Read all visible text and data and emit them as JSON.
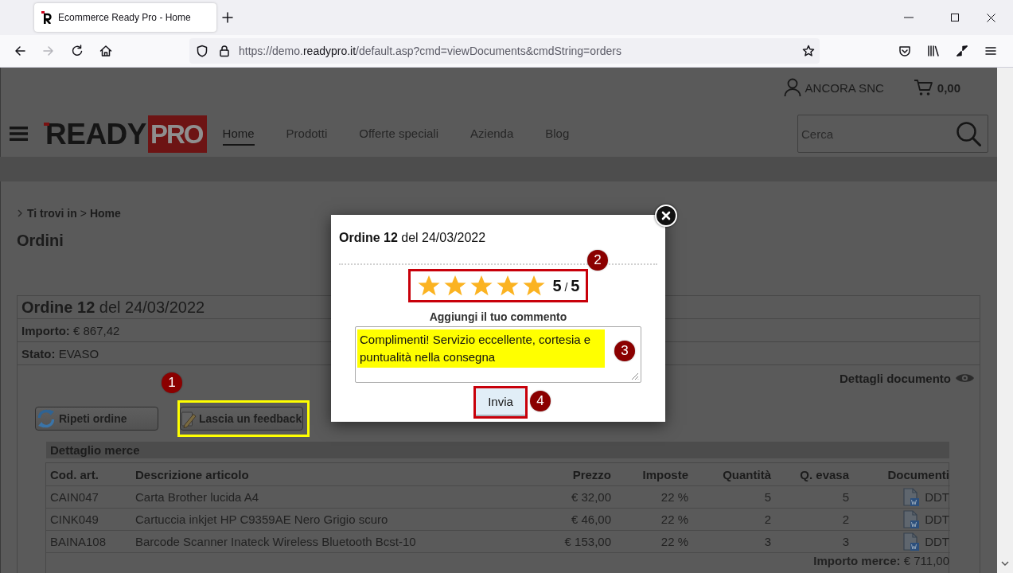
{
  "browser": {
    "tab_title": "Ecommerce Ready Pro - Home",
    "url": {
      "before_host": "https://demo.",
      "host": "readypro.it",
      "after_host": "/default.asp?cmd=viewDocuments&cmdString=orders"
    },
    "forward_disabled": true
  },
  "header": {
    "account": "ANCORA SNC",
    "cart_total": "0,00",
    "logo": {
      "word": "READY",
      "boxed_word": "PRO"
    },
    "nav": [
      {
        "label": "Home",
        "selected": true
      },
      {
        "label": "Prodotti",
        "selected": false
      },
      {
        "label": "Offerte speciali",
        "selected": false
      },
      {
        "label": "Azienda",
        "selected": false
      },
      {
        "label": "Blog",
        "selected": false
      }
    ],
    "search": {
      "placeholder": "Cerca"
    }
  },
  "breadcrumb": {
    "label": "Ti trovi in",
    "separator": ">",
    "current": "Home"
  },
  "page_title": "Ordini",
  "order": {
    "title": "**Ordine 12** del 24/03/2022",
    "amount": "**Importo:** € 867,42",
    "status": "**Stato:** EVASO",
    "details_link": "Dettagli documento",
    "actions": [
      {
        "kind": "repeat",
        "label": "Ripeti ordine",
        "highlighted": false
      },
      {
        "kind": "feedback",
        "label": "Lascia un feedback",
        "highlighted": true,
        "callout": "1"
      }
    ]
  },
  "goods": {
    "title": "Dettaglio merce",
    "columns": [
      "Cod. art.",
      "Descrizione articolo",
      "Prezzo",
      "Imposte",
      "Quantità",
      "Q. evasa",
      "Documenti"
    ],
    "rows": [
      [
        "CAIN047",
        "Carta Brother lucida A4",
        "€ 32,00",
        "22 %",
        "5",
        "5",
        "DDT"
      ],
      [
        "CINK049",
        "Cartuccia inkjet HP C9359AE Nero Grigio scuro",
        "€ 46,00",
        "22 %",
        "2",
        "2",
        "DDT"
      ],
      [
        "BAINA108",
        "Barcode Scanner Inateck Wireless Bluetooth Bcst-10",
        "€ 153,00",
        "22 %",
        "3",
        "3",
        "DDT"
      ]
    ],
    "total": "**Importo merce:** € 711,00"
  },
  "modal": {
    "title": "**Ordine 12** del 24/03/2022",
    "rating": {
      "stars": 5,
      "score": "**5** / **5**",
      "outlined": true,
      "callout": "2"
    },
    "comment": {
      "label": "Aggiungi il tuo commento",
      "value": "Complimenti! Servizio eccellente, cortesia e puntualità nella consegna",
      "marked": true,
      "callout": "3"
    },
    "submit": {
      "label": "Invia",
      "outlined": true,
      "callout": "4"
    }
  }
}
